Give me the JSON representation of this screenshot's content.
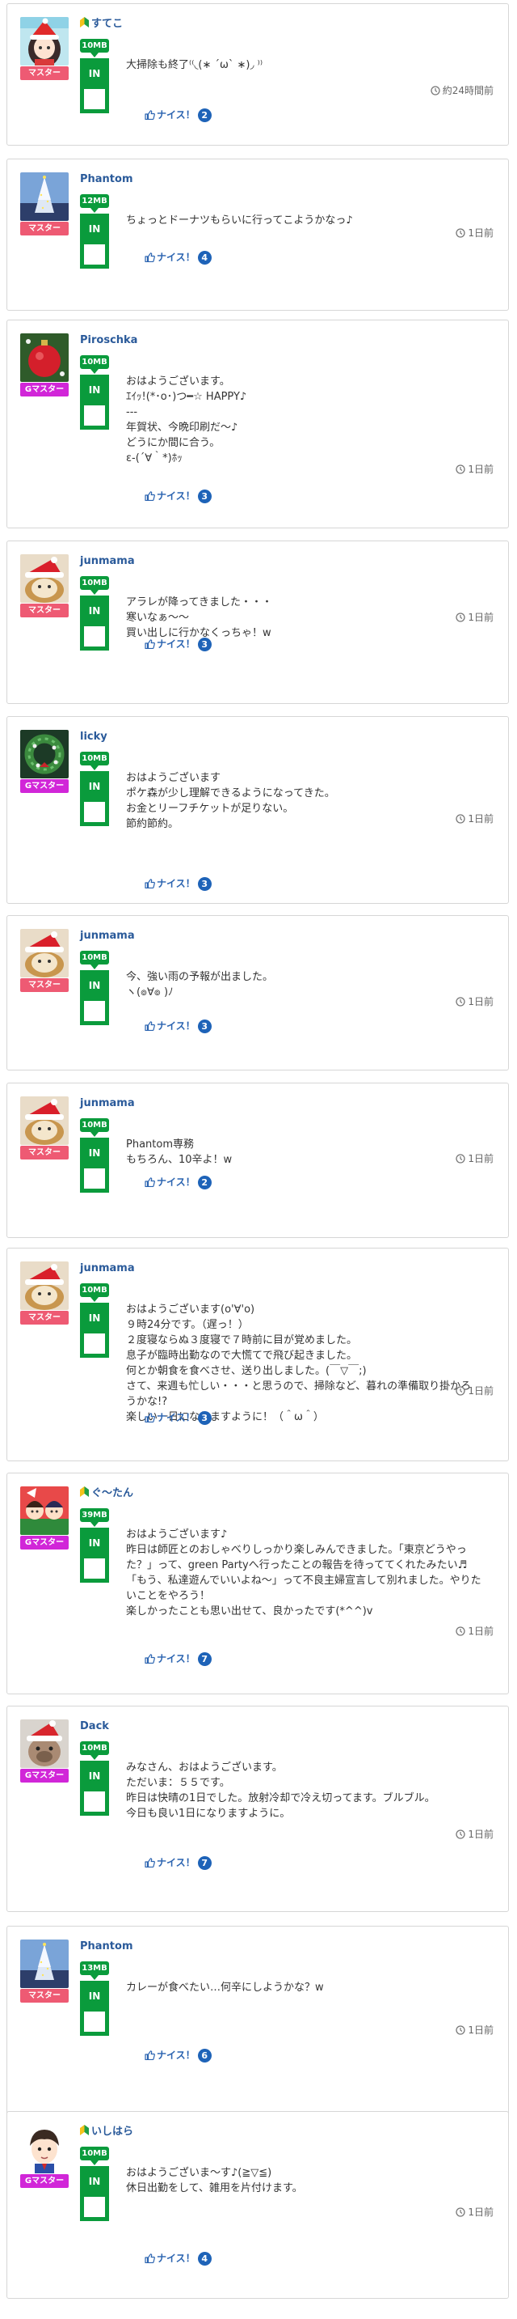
{
  "posts": [
    {
      "username": "すてこ",
      "beginner": true,
      "rank": "マスター",
      "rank_type": "master",
      "size": "10MB",
      "in_label": "IN",
      "message": "大掃除も終了⁽⁽◟(∗ ˊωˋ ∗)◞ ⁾⁾",
      "time": "約24時間前",
      "nice_label": "ナイス！",
      "nice_count": "2",
      "avatar": "anime-girl-santa-hat"
    },
    {
      "username": "Phantom",
      "beginner": false,
      "rank": "マスター",
      "rank_type": "master",
      "size": "12MB",
      "in_label": "IN",
      "message": "ちょっとドーナツもらいに行ってこようかなっ♪",
      "time": "1日前",
      "nice_label": "ナイス！",
      "nice_count": "4",
      "avatar": "christmas-tree-night"
    },
    {
      "username": "Piroschka",
      "beginner": false,
      "rank": "Gマスター",
      "rank_type": "gmaster",
      "size": "10MB",
      "in_label": "IN",
      "message": "おはようございます。\nｴｲｯ!(*･o･)つ━☆ HAPPY♪\n---\n年賀状、今晩印刷だ〜♪\nどうにか間に合う。\nε-(´∀｀*)ﾎｯ",
      "time": "1日前",
      "nice_label": "ナイス！",
      "nice_count": "3",
      "avatar": "red-christmas-ornament"
    },
    {
      "username": "junmama",
      "beginner": false,
      "rank": "マスター",
      "rank_type": "master",
      "size": "10MB",
      "in_label": "IN",
      "message": "アラレが降ってきました・・・\n寒いなぁ〜〜\n買い出しに行かなくっちゃ！w",
      "time": "1日前",
      "nice_label": "ナイス！",
      "nice_count": "3",
      "avatar": "cat-santa-hat"
    },
    {
      "username": "licky",
      "beginner": false,
      "rank": "Gマスター",
      "rank_type": "gmaster",
      "size": "10MB",
      "in_label": "IN",
      "message": "おはようございます\nポケ森が少し理解できるようになってきた。\nお金とリーフチケットが足りない。\n節約節約。",
      "time": "1日前",
      "nice_label": "ナイス！",
      "nice_count": "3",
      "avatar": "christmas-wreath"
    },
    {
      "username": "junmama",
      "beginner": false,
      "rank": "マスター",
      "rank_type": "master",
      "size": "10MB",
      "in_label": "IN",
      "message": "今、強い雨の予報が出ました。\nヽ(๏∀๏ )ﾉ",
      "time": "1日前",
      "nice_label": "ナイス！",
      "nice_count": "3",
      "avatar": "cat-santa-hat"
    },
    {
      "username": "junmama",
      "beginner": false,
      "rank": "マスター",
      "rank_type": "master",
      "size": "10MB",
      "in_label": "IN",
      "message": "Phantom専務\nもちろん、10辛よ！w",
      "time": "1日前",
      "nice_label": "ナイス！",
      "nice_count": "2",
      "avatar": "cat-santa-hat"
    },
    {
      "username": "junmama",
      "beginner": false,
      "rank": "マスター",
      "rank_type": "master",
      "size": "10MB",
      "in_label": "IN",
      "message": "おはようございます(o'∀'o)\n９時24分です。（遅っ！）\n２度寝ならぬ３度寝で７時前に目が覚めました。\n息子が臨時出勤なので大慌てで飛び起きました。\n何とか朝食を食べさせ、送り出しました。(￣▽￣;)\nさて、来週も忙しい・・・と思うので、掃除など、暮れの準備取り掛かろうかな!?\n楽しい一日になりますように！（＾ω＾）",
      "time": "1日前",
      "nice_label": "ナイス！",
      "nice_count": "3",
      "avatar": "cat-santa-hat"
    },
    {
      "username": "ぐ〜たん",
      "beginner": true,
      "rank": "Gマスター",
      "rank_type": "gmaster",
      "size": "39MB",
      "in_label": "IN",
      "message": "おはようございます♪\n昨日は師匠とのおしゃべりしっかり楽しみんできました。「東京どうやった？」って、green Partyへ行ったことの報告を待っててくれたみたい♬\n「もう、私達遊んでいいよね〜」って不良主婦宣言して別れました。やりたいことをやろう！\n楽しかったことも思い出せて、良かったです(*^^)v",
      "time": "1日前",
      "nice_label": "ナイス！",
      "nice_count": "7",
      "avatar": "anime-characters-red"
    },
    {
      "username": "Dack",
      "beginner": false,
      "rank": "Gマスター",
      "rank_type": "gmaster",
      "size": "10MB",
      "in_label": "IN",
      "message": "みなさん、おはようございます。\nただいま：５５です。\n昨日は快晴の1日でした。放射冷却で冷え切ってます。ブルブル。\n今日も良い1日になりますように。",
      "time": "1日前",
      "nice_label": "ナイス！",
      "nice_count": "7",
      "avatar": "dog-santa-hat"
    },
    {
      "username": "Phantom",
      "beginner": false,
      "rank": "マスター",
      "rank_type": "master",
      "size": "13MB",
      "in_label": "IN",
      "message": "カレーが食べたい…何辛にしようかな？w",
      "time": "1日前",
      "nice_label": "ナイス！",
      "nice_count": "6",
      "avatar": "christmas-tree-night"
    },
    {
      "username": "いしはら",
      "beginner": true,
      "rank": "Gマスター",
      "rank_type": "gmaster",
      "size": "10MB",
      "in_label": "IN",
      "message": "おはようございま〜す♪(≧▽≦)\n休日出勤をして、雑用を片付けます。",
      "time": "1日前",
      "nice_label": "ナイス！",
      "nice_count": "4",
      "avatar": "anime-boy-cartoon"
    }
  ],
  "colors": {
    "master_badge": "#ee5a73",
    "gmaster_badge": "#d126d8",
    "size_green": "#0a9b3c",
    "username_blue": "#2a5a9a",
    "nice_blue": "#2a63b0"
  }
}
